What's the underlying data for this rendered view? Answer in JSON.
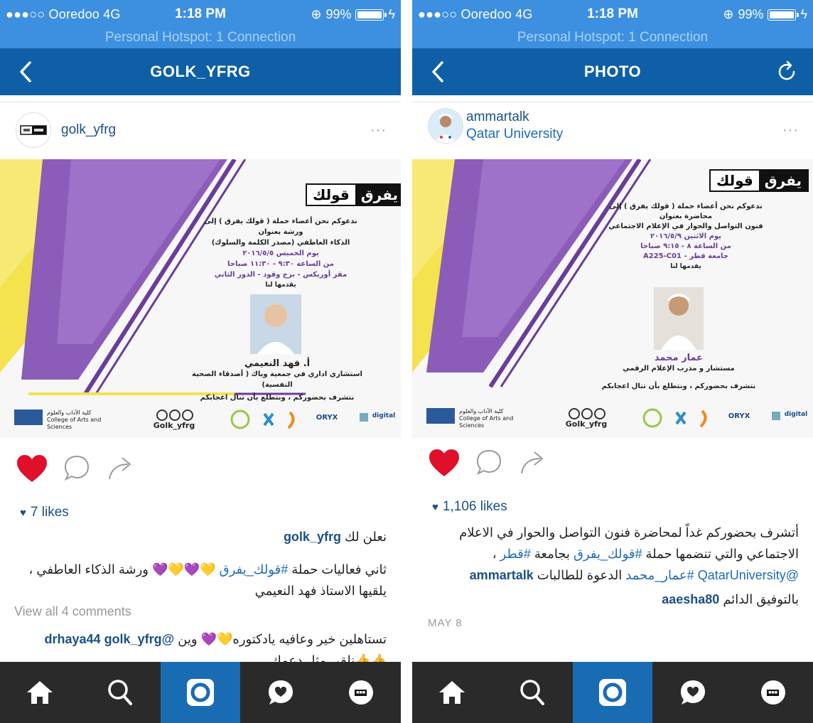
{
  "left": {
    "status": {
      "carrier": "●●●○○ Ooredoo  4G",
      "time": "1:18 PM",
      "battery": "99%",
      "hotspot": "Personal Hotspot: 1 Connection"
    },
    "nav": {
      "title": "GOLK_YFRG"
    },
    "post": {
      "username": "golk_yfrg",
      "more": "···",
      "poster": {
        "logo_a": "قولك",
        "logo_b": "يفرق",
        "invite": "ندعوكم نحن أعضاء حملة ( قولك يفرق ) إلى",
        "event_type": "ورشة بعنوان",
        "event_title": "الذكاء العاطفي (مصدر الكلمة والسلوك)",
        "day": "يوم الخميس ٢٠١٦/٥/٥",
        "time": "من الساعة ٩:٣٠ - ١١:٣٠ صباحا",
        "venue": "مقر أوريكس - برج وقود - الدور الثاني",
        "presenter_intro": "يقدمها لنا",
        "speaker": "أ. فهد النعيمي",
        "speaker_role": "استشاري اداري في جمعية وياك ( أصدقاء الصحية النفسية)",
        "closing": "نتشرف بحضوركم ، ونتطلع بأن تنال اعجابكم",
        "college_ar": "كلية الآداب والعلوم",
        "college_en": "College of Arts and Sciences",
        "handle": "Golk_yfrg",
        "sponsor_oryx": "ORYX",
        "sponsor_digital": "digital"
      },
      "likes": "7 likes",
      "caption_user": "golk_yfrg",
      "caption_text": "نعلن لك",
      "caption2_text_a": "ثاني فعاليات حملة ",
      "caption2_tag": "#قولك_يفرق",
      "caption2_text_b": " 💛💜💛💜 ورشة الذكاء العاطفي ، يلقيها الاستاذ فهد النعيمي",
      "view_all": "View all 4 comments",
      "comment_user": "golk_yfrg",
      "comment_mention": "@drhaya44",
      "comment_text": "تستاهلين خير وعافيه يادكتوره💛💜 وين",
      "comment_text2": "👍👍نلقى مثل دعمك"
    }
  },
  "right": {
    "status": {
      "carrier": "●●●○○ Ooredoo  4G",
      "time": "1:18 PM",
      "battery": "99%",
      "hotspot": "Personal Hotspot: 1 Connection"
    },
    "nav": {
      "title": "PHOTO"
    },
    "post": {
      "username": "ammartalk",
      "location": "Qatar University",
      "more": "···",
      "poster": {
        "logo_a": "قولك",
        "logo_b": "يفرق",
        "invite": "ندعوكم نحن أعضاء حملة ( قولك يفرق ) إلى",
        "event_type": "محاضرة بعنوان",
        "event_title": "فنون التواصل والحوار في الإعلام الاجتماعي",
        "day": "يوم الاثنين ٢٠١٦/٥/٩",
        "time": "من الساعة ٨ - ٩:١٥ صباحا",
        "venue": "جامعة قطر - A225-C01",
        "presenter_intro": "يقدمها لنا",
        "speaker": "عمار محمد",
        "speaker_role": "مستشار و مدرب الإعلام الرقمي",
        "closing": "نتشرف بحضوركم ، ونتطلع بأن تنال اعجابكم",
        "college_ar": "كلية الآداب والعلوم",
        "college_en": "College of Arts and Sciences",
        "handle": "Golk_yfrg",
        "sponsor_oryx": "ORYX",
        "sponsor_digital": "digital"
      },
      "likes": "1,106 likes",
      "caption_user": "ammartalk",
      "caption_text_a": "أتشرف بحضوركم غداً لمحاضرة فنون التواصل والحوار في الاعلام الاجتماعي والتي تنضمها حملة ",
      "caption_tag1": "#قولك_يفرق",
      "caption_text_b": " بجامعة ",
      "caption_tag2": "#قطر",
      "caption_text_c": " ، ",
      "caption_mention": "@QatarUniversity",
      "caption_tag3": "#عمار_محمد",
      "caption_text_d": " الدعوة للطالبات",
      "comment_user": "aaesha80",
      "comment_text": "بالتوفيق الدائم",
      "date": "MAY 8"
    }
  },
  "colors": {
    "status_bar": "#3d8fe0",
    "nav_bar": "#0f5fa6",
    "tab_bar": "#2a2a2a",
    "tab_active": "#1a6cb2",
    "heart": "#e0102a",
    "link": "#1c4f86"
  }
}
